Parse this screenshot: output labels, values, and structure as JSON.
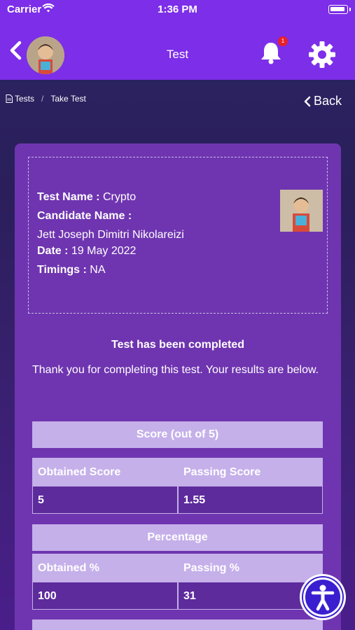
{
  "status": {
    "carrier": "Carrier",
    "time": "1:36 PM"
  },
  "header": {
    "title": "Test",
    "notification_count": "1"
  },
  "breadcrumb": {
    "root": "Tests",
    "current": "Take Test",
    "separator": "/"
  },
  "back": {
    "label": "Back"
  },
  "test": {
    "name_label": "Test Name :",
    "name_value": "Crypto",
    "candidate_label": "Candidate Name :",
    "candidate_value": "Jett Joseph Dimitri Nikolareizi",
    "date_label": "Date :",
    "date_value": "19 May 2022",
    "timings_label": "Timings :",
    "timings_value": "NA"
  },
  "result": {
    "title": "Test has been completed",
    "message": "Thank you for completing this test. Your results are below."
  },
  "score": {
    "heading": "Score (out of 5)",
    "obtained_label": "Obtained Score",
    "passing_label": "Passing Score",
    "obtained_value": "5",
    "passing_value": "1.55"
  },
  "percentage": {
    "heading": "Percentage",
    "obtained_label": "Obtained %",
    "passing_label": "Passing %",
    "obtained_value": "100",
    "passing_value": "31"
  },
  "colors": {
    "header": "#7c2ee8",
    "card": "#6f35b0",
    "cell_label": "#c5b0ea",
    "accessibility": "#3a1fd0"
  }
}
